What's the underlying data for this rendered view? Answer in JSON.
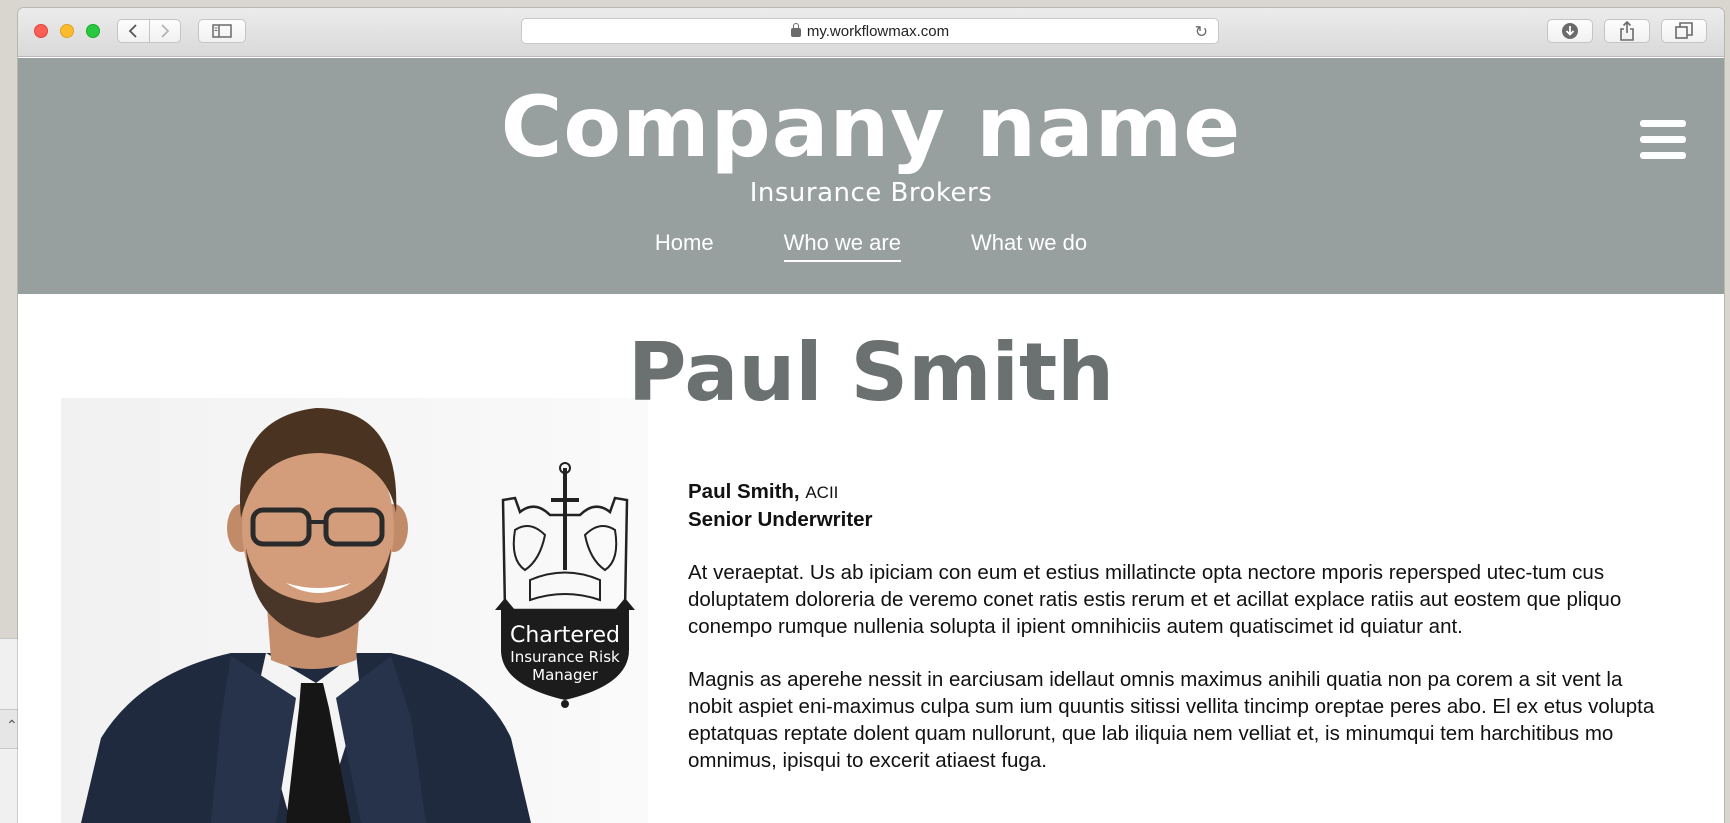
{
  "browser": {
    "url": "my.workflowmax.com"
  },
  "site": {
    "company_name": "Company name",
    "tagline": "Insurance Brokers",
    "nav": [
      {
        "label": "Home",
        "active": false
      },
      {
        "label": "Who we are",
        "active": true
      },
      {
        "label": "What we do",
        "active": false
      }
    ]
  },
  "profile": {
    "heading": "Paul Smith",
    "name": "Paul Smith,",
    "credential": "ACII",
    "role": "Senior Underwriter",
    "badge": {
      "line1": "Chartered",
      "line2": "Insurance Risk",
      "line3": "Manager"
    },
    "paragraphs": [
      "At veraeptat. Us ab ipiciam con eum et estius millatincte opta nectore mporis repersped utec-tum cus doluptatem doloreria de veremo conet ratis estis rerum et et acillat explace ratiis aut eostem que pliquo conempo rumque nullenia solupta il ipient omnihiciis autem quatiscimet id quiatur ant.",
      "Magnis as aperehe nessit in earciusam idellaut omnis maximus anihili quatia non pa corem a sit vent la nobit aspiet eni-maximus culpa sum ium quuntis sitissi vellita tincimp oreptae peres abo. El ex etus volupta eptatquas reptate dolent quam nullorunt, que lab iliquia nem velliat et, is minumqui tem harchitibus mo omnimus, ipisqui to excerit atiaest fuga."
    ]
  },
  "colors": {
    "header_bg": "#989f9f",
    "heading_gray": "#6b7070"
  }
}
